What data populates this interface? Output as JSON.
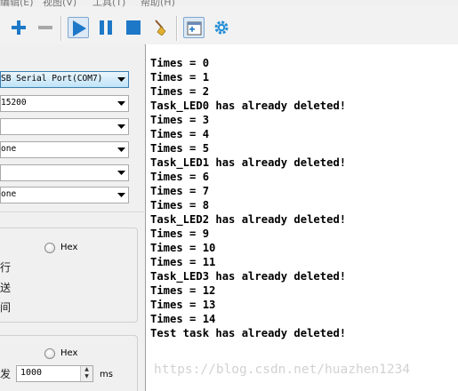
{
  "menu": {
    "items": [
      "编辑(E)",
      "视图(V)",
      "工具(T)",
      "帮助(H)"
    ]
  },
  "toolbar": {
    "buttons": [
      {
        "name": "add-icon"
      },
      {
        "name": "remove-icon"
      },
      {
        "name": "play-icon"
      },
      {
        "name": "pause-icon"
      },
      {
        "name": "stop-icon"
      },
      {
        "name": "broom-icon"
      },
      {
        "name": "new-window-icon"
      },
      {
        "name": "gear-icon"
      }
    ],
    "accent": "#1e78c8"
  },
  "settings": {
    "port": "SB Serial Port(COM7)",
    "baud": "15200",
    "data_bits": "",
    "parity": "one",
    "stop_bits": "",
    "flow": "one"
  },
  "receive": {
    "hex_label": "Hex",
    "cjk_row1": "行",
    "cjk_row2": "送",
    "cjk_row3": "间"
  },
  "send": {
    "hex_label": "Hex",
    "interval_label": "发",
    "interval_value": "1000",
    "interval_unit": "ms"
  },
  "terminal": {
    "lines": [
      "Times = 0",
      "Times = 1",
      "Times = 2",
      "Task_LED0 has already deleted!",
      "Times = 3",
      "Times = 4",
      "Times = 5",
      "Task_LED1 has already deleted!",
      "Times = 6",
      "Times = 7",
      "Times = 8",
      "Task_LED2 has already deleted!",
      "Times = 9",
      "Times = 10",
      "Times = 11",
      "Task_LED3 has already deleted!",
      "Times = 12",
      "Times = 13",
      "Times = 14",
      "Test task has already deleted!"
    ]
  },
  "watermark": "https://blog.csdn.net/huazhen1234"
}
